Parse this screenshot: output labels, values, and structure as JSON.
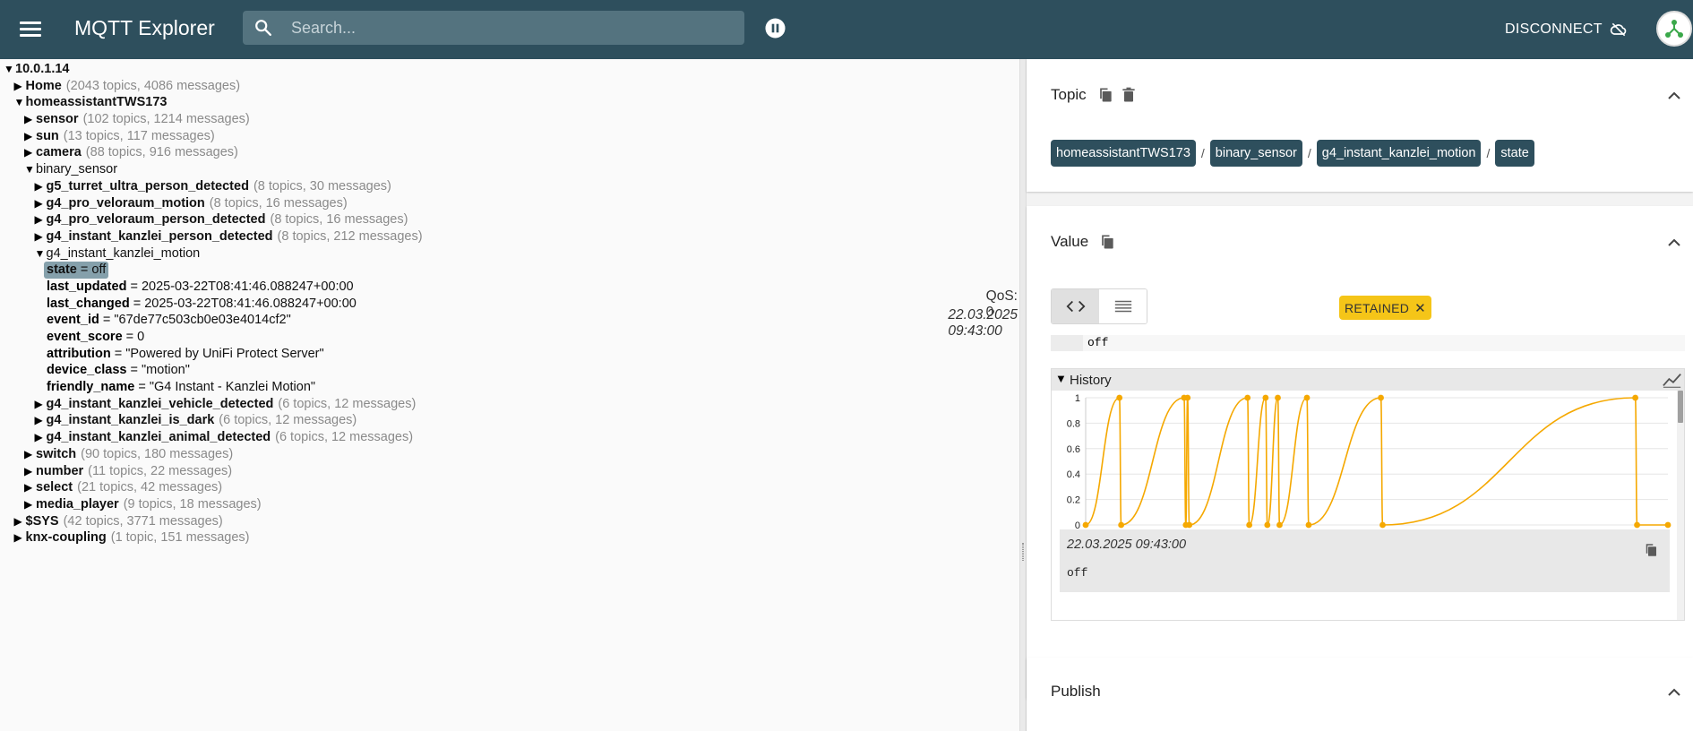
{
  "app": {
    "title": "MQTT Explorer"
  },
  "search": {
    "placeholder": "Search..."
  },
  "header": {
    "disconnect_label": "DISCONNECT"
  },
  "tree": {
    "rows": [
      {
        "indent": 0,
        "type": "node",
        "open": true,
        "name": "10.0.1.14",
        "meta": ""
      },
      {
        "indent": 1,
        "type": "node",
        "open": false,
        "name": "Home",
        "meta": "(2043 topics, 4086 messages)"
      },
      {
        "indent": 1,
        "type": "node",
        "open": true,
        "name": "homeassistantTWS173",
        "meta": ""
      },
      {
        "indent": 2,
        "type": "node",
        "open": false,
        "name": "sensor",
        "meta": "(102 topics, 1214 messages)"
      },
      {
        "indent": 2,
        "type": "node",
        "open": false,
        "name": "sun",
        "meta": "(13 topics, 117 messages)"
      },
      {
        "indent": 2,
        "type": "node",
        "open": false,
        "name": "camera",
        "meta": "(88 topics, 916 messages)"
      },
      {
        "indent": 2,
        "type": "node",
        "open": true,
        "name": "binary_sensor",
        "meta": "",
        "plain": true
      },
      {
        "indent": 3,
        "type": "node",
        "open": false,
        "name": "g5_turret_ultra_person_detected",
        "meta": "(8 topics, 30 messages)"
      },
      {
        "indent": 3,
        "type": "node",
        "open": false,
        "name": "g4_pro_veloraum_motion",
        "meta": "(8 topics, 16 messages)"
      },
      {
        "indent": 3,
        "type": "node",
        "open": false,
        "name": "g4_pro_veloraum_person_detected",
        "meta": "(8 topics, 16 messages)"
      },
      {
        "indent": 3,
        "type": "node",
        "open": false,
        "name": "g4_instant_kanzlei_person_detected",
        "meta": "(8 topics, 212 messages)"
      },
      {
        "indent": 3,
        "type": "node",
        "open": true,
        "name": "g4_instant_kanzlei_motion",
        "meta": "",
        "plain": true
      },
      {
        "indent": 4,
        "type": "kv",
        "key": "state",
        "val": " = off",
        "selected": true
      },
      {
        "indent": 4,
        "type": "kv",
        "key": "last_updated",
        "val": " = 2025-03-22T08:41:46.088247+00:00"
      },
      {
        "indent": 4,
        "type": "kv",
        "key": "last_changed",
        "val": " = 2025-03-22T08:41:46.088247+00:00"
      },
      {
        "indent": 4,
        "type": "kv",
        "key": "event_id",
        "val": " = \"67de77c503cb0e03e4014cf2\""
      },
      {
        "indent": 4,
        "type": "kv",
        "key": "event_score",
        "val": " = 0"
      },
      {
        "indent": 4,
        "type": "kv",
        "key": "attribution",
        "val": " = \"Powered by UniFi Protect Server\""
      },
      {
        "indent": 4,
        "type": "kv",
        "key": "device_class",
        "val": " = \"motion\""
      },
      {
        "indent": 4,
        "type": "kv",
        "key": "friendly_name",
        "val": " = \"G4 Instant - Kanzlei Motion\""
      },
      {
        "indent": 3,
        "type": "node",
        "open": false,
        "name": "g4_instant_kanzlei_vehicle_detected",
        "meta": "(6 topics, 12 messages)"
      },
      {
        "indent": 3,
        "type": "node",
        "open": false,
        "name": "g4_instant_kanzlei_is_dark",
        "meta": "(6 topics, 12 messages)"
      },
      {
        "indent": 3,
        "type": "node",
        "open": false,
        "name": "g4_instant_kanzlei_animal_detected",
        "meta": "(6 topics, 12 messages)"
      },
      {
        "indent": 2,
        "type": "node",
        "open": false,
        "name": "switch",
        "meta": "(90 topics, 180 messages)"
      },
      {
        "indent": 2,
        "type": "node",
        "open": false,
        "name": "number",
        "meta": "(11 topics, 22 messages)"
      },
      {
        "indent": 2,
        "type": "node",
        "open": false,
        "name": "select",
        "meta": "(21 topics, 42 messages)"
      },
      {
        "indent": 2,
        "type": "node",
        "open": false,
        "name": "media_player",
        "meta": "(9 topics, 18 messages)"
      },
      {
        "indent": 1,
        "type": "node",
        "open": false,
        "name": "$SYS",
        "meta": "(42 topics, 3771 messages)"
      },
      {
        "indent": 1,
        "type": "node",
        "open": false,
        "name": "knx-coupling",
        "meta": "(1 topic, 151 messages)"
      }
    ]
  },
  "topic": {
    "title": "Topic",
    "breadcrumbs": [
      "homeassistantTWS173",
      "binary_sensor",
      "g4_instant_kanzlei_motion",
      "state"
    ],
    "separator": "/"
  },
  "value": {
    "title": "Value",
    "retained_label": "RETAINED",
    "qos": "QoS: 0",
    "timestamp": "22.03.2025 09:43:00",
    "raw": "off"
  },
  "history": {
    "title": "History",
    "y_ticks": [
      "1",
      "0.8",
      "0.6",
      "0.4",
      "0.2",
      "0"
    ],
    "entry_timestamp": "22.03.2025 09:43:00",
    "entry_value": "off"
  },
  "chart_data": {
    "type": "line",
    "ylim": [
      0,
      1
    ],
    "y_ticks": [
      0,
      0.2,
      0.4,
      0.6,
      0.8,
      1
    ],
    "grid": true,
    "color": "#f5a800",
    "x": [
      0,
      0.058,
      0.061,
      0.169,
      0.172,
      0.175,
      0.178,
      0.278,
      0.281,
      0.309,
      0.312,
      0.33,
      0.333,
      0.38,
      0.383,
      0.507,
      0.51,
      0.944,
      0.947,
      1.0
    ],
    "values": [
      0,
      1,
      0,
      1,
      0,
      1,
      0,
      1,
      0,
      1,
      0,
      1,
      0,
      1,
      0,
      1,
      0,
      1,
      0,
      0
    ]
  },
  "publish": {
    "title": "Publish"
  },
  "colors": {
    "appbar": "#2e4f5d",
    "accent": "#f5a800",
    "retained": "#f5c518",
    "breadcrumb": "#2e4f5d"
  }
}
